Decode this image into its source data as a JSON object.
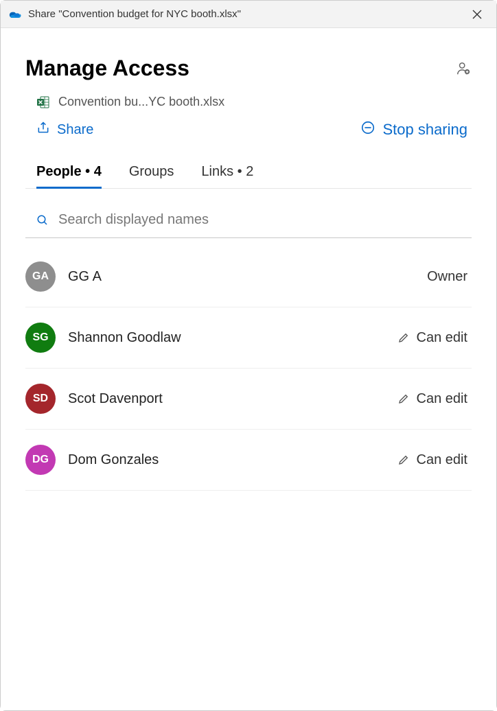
{
  "window": {
    "title": "Share \"Convention budget for NYC booth.xlsx\""
  },
  "header": {
    "title": "Manage Access",
    "file_name": "Convention bu...YC booth.xlsx"
  },
  "actions": {
    "share": "Share",
    "stop_sharing": "Stop sharing"
  },
  "tabs": {
    "people": {
      "label": "People",
      "count": "4"
    },
    "groups": {
      "label": "Groups"
    },
    "links": {
      "label": "Links",
      "count": "2"
    }
  },
  "search": {
    "placeholder": "Search displayed names"
  },
  "people": [
    {
      "initials": "GA",
      "name": "GG A",
      "role": "Owner",
      "color": "#8e8e8e",
      "editable": false
    },
    {
      "initials": "SG",
      "name": "Shannon Goodlaw",
      "role": "Can edit",
      "color": "#107c10",
      "editable": true
    },
    {
      "initials": "SD",
      "name": "Scot Davenport",
      "role": "Can edit",
      "color": "#a4262c",
      "editable": true
    },
    {
      "initials": "DG",
      "name": "Dom Gonzales",
      "role": "Can edit",
      "color": "#c239b3",
      "editable": true
    }
  ]
}
